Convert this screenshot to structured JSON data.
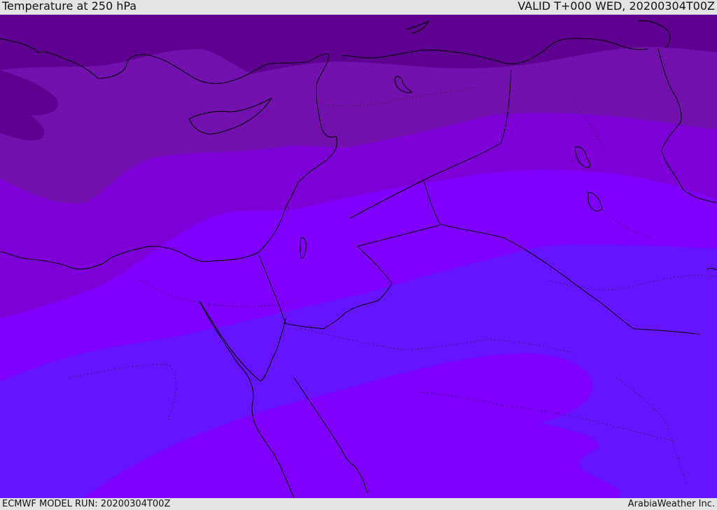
{
  "header": {
    "title": "Temperature at 250 hPa",
    "valid": "VALID T+000 WED, 20200304T00Z"
  },
  "footer": {
    "model_run": "ECMWF MODEL RUN: 20200304T00Z",
    "credit": "ArabiaWeather Inc."
  },
  "map": {
    "field": "temperature",
    "level_hpa": 250,
    "colors": {
      "band_coldest": "#5e0090",
      "band_2": "#7311ae",
      "band_3": "#7d00d6",
      "band_4": "#8000ff",
      "band_5": "#6614ff",
      "coast": "#000000"
    }
  }
}
